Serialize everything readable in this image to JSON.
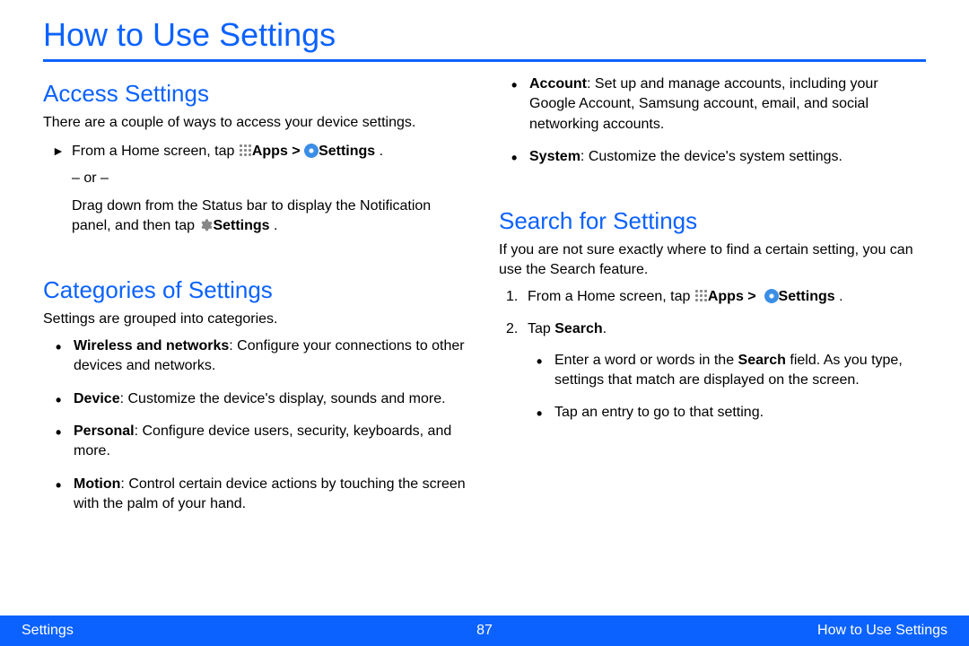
{
  "page_title": "How to Use Settings",
  "sections": {
    "access": {
      "heading": "Access Settings",
      "intro": "There are a couple of ways to access your device settings.",
      "step1_a": "From a Home screen, tap ",
      "apps_label": "Apps > ",
      "settings_label": "Settings",
      "period": " .",
      "or_text": "– or –",
      "step1_b_before": "Drag down from the Status bar to display the Notification panel, and then tap ",
      "step1_b_bold": "Settings",
      "step1_b_after": " ."
    },
    "categories": {
      "heading": "Categories of Settings",
      "intro": "Settings are grouped into categories.",
      "items": [
        {
          "bold": "Wireless and networks",
          "text": ": Configure your connections to other devices and networks."
        },
        {
          "bold": "Device",
          "text": ": Customize the device's display, sounds and more."
        },
        {
          "bold": "Personal",
          "text": ": Configure device users, security, keyboards, and more."
        },
        {
          "bold": "Motion",
          "text": ": Control certain device actions by touching the screen with the palm of your hand."
        },
        {
          "bold": "Account",
          "text": ": Set up and manage accounts, including your Google Account, Samsung account, email, and social networking accounts."
        },
        {
          "bold": "System",
          "text": ": Customize the device's system settings."
        }
      ]
    },
    "search": {
      "heading": "Search for Settings",
      "intro": "If you are not sure exactly where to find a certain setting, you can use the Search feature.",
      "step1_a": "From a Home screen, tap ",
      "apps_label": "Apps > ",
      "settings_label": "Settings",
      "step2_before": "Tap ",
      "step2_bold": "Search",
      "step2_after": ".",
      "sub": [
        {
          "before": "Enter a word or words in the ",
          "bold": "Search",
          "after": " field. As you type, settings that match are displayed on the screen."
        },
        {
          "before": "Tap an entry to go to that setting.",
          "bold": "",
          "after": ""
        }
      ]
    }
  },
  "footer": {
    "left": "Settings",
    "center": "87",
    "right": "How to Use Settings"
  }
}
